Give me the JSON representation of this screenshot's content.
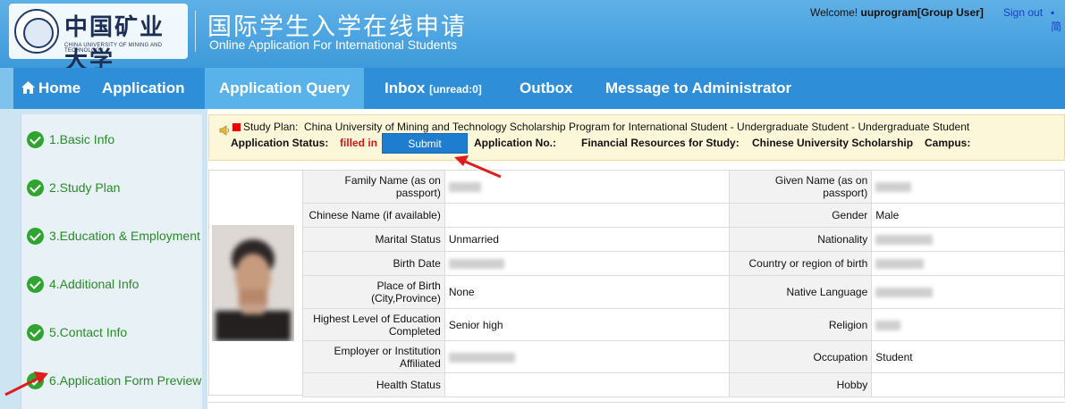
{
  "header": {
    "logo_cn": "中国矿业大学",
    "logo_en": "CHINA UNIVERSITY OF MINING AND TECHNOLOGY",
    "title_cn": "国际学生入学在线申请",
    "title_en": "Online Application For International Students",
    "welcome_prefix": "Welcome!",
    "welcome_user": "uuprogram[Group User]",
    "sign_out": "Sign out",
    "lang_link": "▪简"
  },
  "nav": {
    "home": "Home",
    "application": "Application",
    "application_query": "Application Query",
    "inbox": "Inbox",
    "inbox_unread": "[unread:0]",
    "outbox": "Outbox",
    "message_admin": "Message to Administrator"
  },
  "sidebar": {
    "items": [
      {
        "label": "1.Basic Info"
      },
      {
        "label": "2.Study Plan"
      },
      {
        "label": "3.Education & Employment"
      },
      {
        "label": "4.Additional Info"
      },
      {
        "label": "5.Contact Info"
      },
      {
        "label": "6.Application Form Preview"
      }
    ]
  },
  "status_bar": {
    "study_plan_label": "Study Plan:",
    "study_plan_value": "China University of Mining and Technology Scholarship Program for International Student - Undergraduate Student - Undergraduate Student",
    "application_status_label": "Application Status:",
    "application_status_value": "filled in",
    "submit_label": "Submit",
    "application_no_label": "Application No.:",
    "financial_label": "Financial Resources for Study:",
    "financial_value": "Chinese University Scholarship",
    "campus_label": "Campus:"
  },
  "info": {
    "family_name_label": "Family Name (as on passport)",
    "given_name_label": "Given Name (as on passport)",
    "chinese_name_label": "Chinese Name (if available)",
    "chinese_name_value": "",
    "gender_label": "Gender",
    "gender_value": "Male",
    "marital_label": "Marital Status",
    "marital_value": "Unmarried",
    "nationality_label": "Nationality",
    "birth_date_label": "Birth Date",
    "country_label": "Country or region of birth",
    "place_birth_label": "Place of Birth (City,Province)",
    "place_birth_value": "None",
    "native_lang_label": "Native Language",
    "education_label": "Highest Level of Education Completed",
    "education_value": "Senior high",
    "religion_label": "Religion",
    "employer_label": "Employer or Institution Affiliated",
    "occupation_label": "Occupation",
    "occupation_value": "Student",
    "health_label": "Health Status",
    "health_value": "",
    "hobby_label": "Hobby",
    "hobby_value": ""
  },
  "colors": {
    "header_blue": "#4aa3e0",
    "nav_blue": "#2e8fd8",
    "nav_active": "#59b3ea",
    "status_red": "#d41515",
    "step_green": "#2a8a2a",
    "arrow_red": "#e01d1d"
  }
}
